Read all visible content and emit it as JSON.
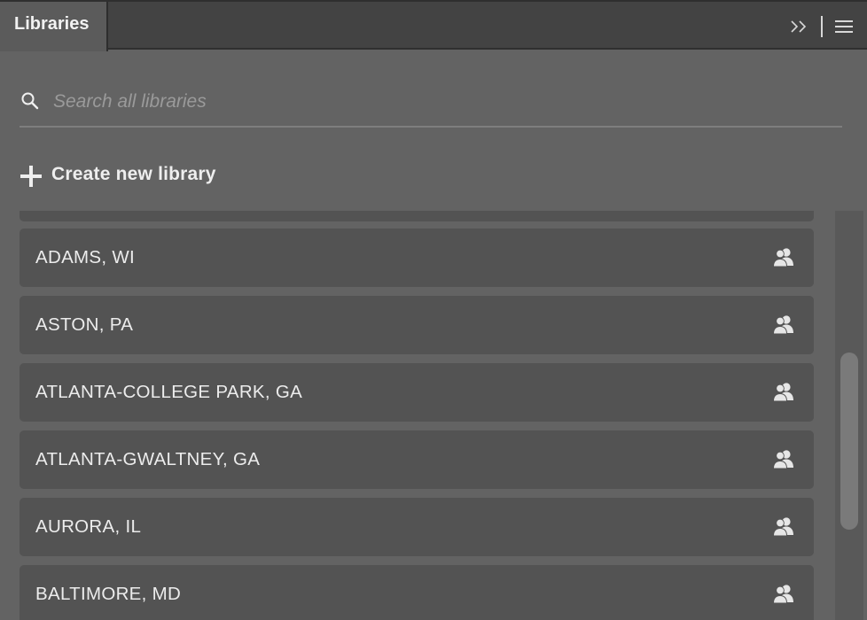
{
  "panel": {
    "tab_label": "Libraries"
  },
  "header": {
    "collapse_icon": "double-chevron-right-icon",
    "menu_icon": "hamburger-menu-icon"
  },
  "search": {
    "placeholder": "Search all libraries",
    "value": "",
    "icon": "search-icon"
  },
  "create": {
    "label": "Create new library",
    "icon": "plus-icon"
  },
  "libraries": [
    {
      "name": "ADAMS, WI",
      "icon": "shared-users-icon"
    },
    {
      "name": "ASTON, PA",
      "icon": "shared-users-icon"
    },
    {
      "name": "ATLANTA-COLLEGE PARK, GA",
      "icon": "shared-users-icon"
    },
    {
      "name": "ATLANTA-GWALTNEY, GA",
      "icon": "shared-users-icon"
    },
    {
      "name": "AURORA, IL",
      "icon": "shared-users-icon"
    },
    {
      "name": "BALTIMORE, MD",
      "icon": "shared-users-icon"
    }
  ],
  "colors": {
    "panel_bg": "#636363",
    "header_bg": "#434343",
    "item_bg": "#535353",
    "text": "#ececec",
    "placeholder": "#9a9a9a"
  }
}
